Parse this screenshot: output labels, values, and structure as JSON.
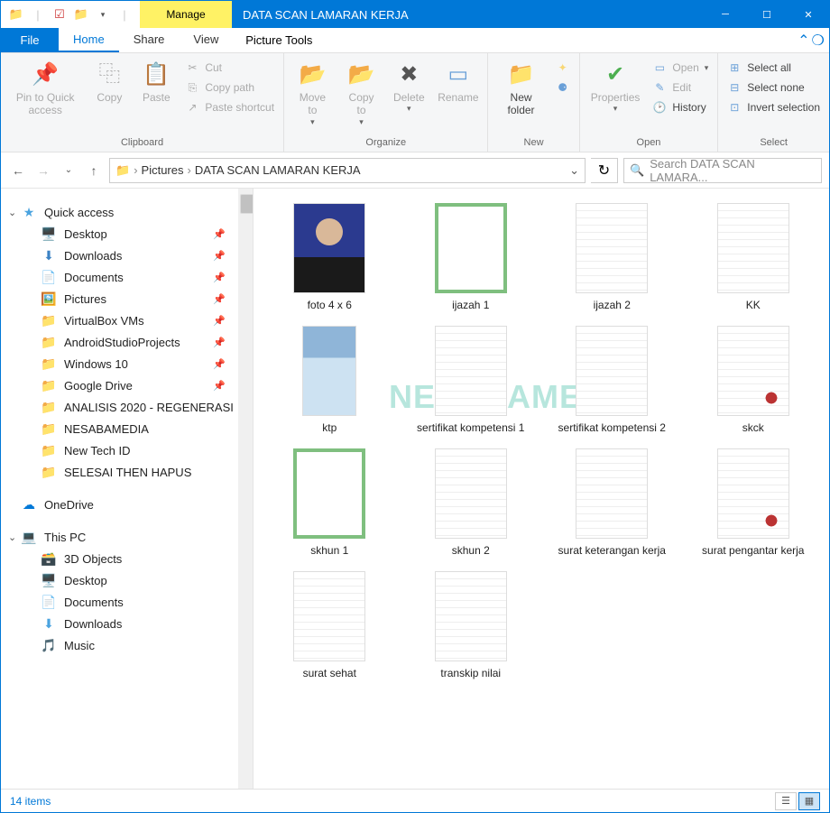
{
  "titlebar": {
    "context_tab": "Manage",
    "context_sub": "Picture Tools",
    "title": "DATA SCAN LAMARAN KERJA"
  },
  "tabs": {
    "file": "File",
    "home": "Home",
    "share": "Share",
    "view": "View",
    "picture_tools": "Picture Tools"
  },
  "ribbon": {
    "clipboard": {
      "label": "Clipboard",
      "pin": "Pin to Quick access",
      "copy": "Copy",
      "paste": "Paste",
      "cut": "Cut",
      "copy_path": "Copy path",
      "paste_shortcut": "Paste shortcut"
    },
    "organize": {
      "label": "Organize",
      "move_to": "Move to",
      "copy_to": "Copy to",
      "delete": "Delete",
      "rename": "Rename"
    },
    "new": {
      "label": "New",
      "new_folder": "New folder"
    },
    "open": {
      "label": "Open",
      "properties": "Properties",
      "open": "Open",
      "edit": "Edit",
      "history": "History"
    },
    "select": {
      "label": "Select",
      "select_all": "Select all",
      "select_none": "Select none",
      "invert": "Invert selection"
    }
  },
  "breadcrumb": {
    "root_icon": "folder",
    "items": [
      "Pictures",
      "DATA SCAN LAMARAN KERJA"
    ]
  },
  "search": {
    "placeholder": "Search DATA SCAN LAMARA..."
  },
  "sidebar": {
    "quick_access": "Quick access",
    "items_pinned": [
      {
        "icon": "🖥️",
        "label": "Desktop",
        "pinned": true
      },
      {
        "icon": "⬇",
        "label": "Downloads",
        "pinned": true,
        "color": "#3b82c4"
      },
      {
        "icon": "📄",
        "label": "Documents",
        "pinned": true
      },
      {
        "icon": "🖼️",
        "label": "Pictures",
        "pinned": true
      },
      {
        "icon": "📁",
        "label": "VirtualBox VMs",
        "pinned": true
      },
      {
        "icon": "📁",
        "label": "AndroidStudioProjects",
        "pinned": true
      },
      {
        "icon": "📁",
        "label": "Windows 10",
        "pinned": true
      },
      {
        "icon": "📁",
        "label": "Google Drive",
        "pinned": true
      },
      {
        "icon": "📁",
        "label": "ANALISIS 2020 - REGENERASI"
      },
      {
        "icon": "📁",
        "label": "NESABAMEDIA"
      },
      {
        "icon": "📁",
        "label": "New Tech ID"
      },
      {
        "icon": "📁",
        "label": "SELESAI THEN HAPUS"
      }
    ],
    "onedrive": "OneDrive",
    "this_pc": "This PC",
    "pc_items": [
      {
        "icon": "🗃️",
        "label": "3D Objects"
      },
      {
        "icon": "🖥️",
        "label": "Desktop"
      },
      {
        "icon": "📄",
        "label": "Documents"
      },
      {
        "icon": "⬇",
        "label": "Downloads"
      },
      {
        "icon": "🎵",
        "label": "Music"
      }
    ]
  },
  "files": [
    {
      "name": "foto 4 x 6",
      "type": "photo"
    },
    {
      "name": "ijazah 1",
      "type": "cert"
    },
    {
      "name": "ijazah 2",
      "type": "doc"
    },
    {
      "name": "KK",
      "type": "doc"
    },
    {
      "name": "ktp",
      "type": "idcard"
    },
    {
      "name": "sertifikat kompetensi 1",
      "type": "doc"
    },
    {
      "name": "sertifikat kompetensi 2",
      "type": "doc"
    },
    {
      "name": "skck",
      "type": "stamp"
    },
    {
      "name": "skhun 1",
      "type": "cert"
    },
    {
      "name": "skhun 2",
      "type": "doc"
    },
    {
      "name": "surat keterangan kerja",
      "type": "doc"
    },
    {
      "name": "surat pengantar kerja",
      "type": "stamp"
    },
    {
      "name": "surat sehat",
      "type": "doc"
    },
    {
      "name": "transkip nilai",
      "type": "doc"
    }
  ],
  "statusbar": {
    "count": "14 items"
  },
  "watermark": "NESABAMEDIA"
}
